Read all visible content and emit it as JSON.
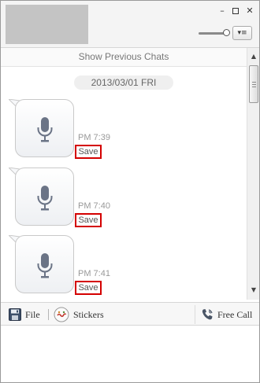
{
  "window": {
    "controls": {
      "minimize": "–",
      "maximize": "",
      "close": "✕"
    },
    "menu_glyph": "▾≡"
  },
  "chat": {
    "show_previous": "Show Previous Chats",
    "date": "2013/03/01 FRI",
    "messages": [
      {
        "type": "voice",
        "icon": "microphone-icon",
        "time": "PM 7:39",
        "save_label": "Save"
      },
      {
        "type": "voice",
        "icon": "microphone-icon",
        "time": "PM 7:40",
        "save_label": "Save"
      },
      {
        "type": "voice",
        "icon": "microphone-icon",
        "time": "PM 7:41",
        "save_label": "Save"
      }
    ]
  },
  "scrollbar": {
    "up": "▲",
    "down": "▼"
  },
  "toolbar": {
    "file_label": "File",
    "stickers_label": "Stickers",
    "call_label": "Free Call"
  },
  "input": {
    "value": ""
  },
  "colors": {
    "save_outline": "#d40000",
    "avatar_placeholder": "#c4c4c4",
    "mic": "#6b7486"
  }
}
